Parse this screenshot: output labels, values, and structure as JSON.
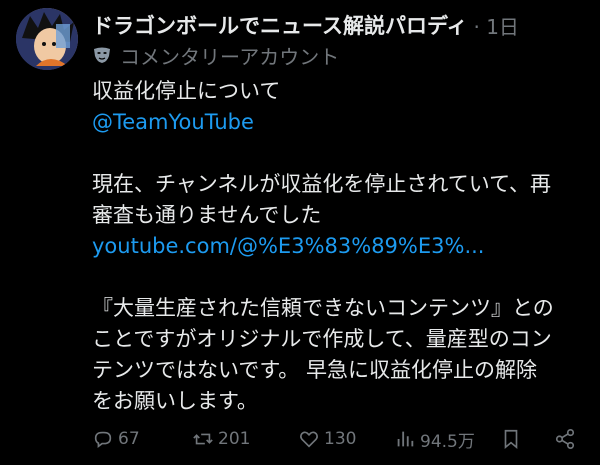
{
  "post": {
    "display_name": "ドラゴンボールでニュース解説パロディ",
    "time": "· 1日",
    "account_label": "コメンタリーアカウント",
    "account_icon": "mask-icon",
    "body_lines": [
      "収益化停止について",
      "@TeamYouTube",
      "",
      "現在、チャンネルが収益化を停止されていて、再",
      "審査も通りませんでした",
      "youtube.com/@%E3%83%89%E3%...",
      "",
      "『大量生産された信頼できないコンテンツ』との",
      "ことですがオリジナルで作成して、量産型のコン",
      "テンツではないです。 早急に収益化停止の解除",
      "をお願いします。"
    ],
    "link_color": "#1d9bf0"
  },
  "actions": {
    "replies": "67",
    "reposts": "201",
    "likes": "130",
    "views": "94.5万"
  }
}
